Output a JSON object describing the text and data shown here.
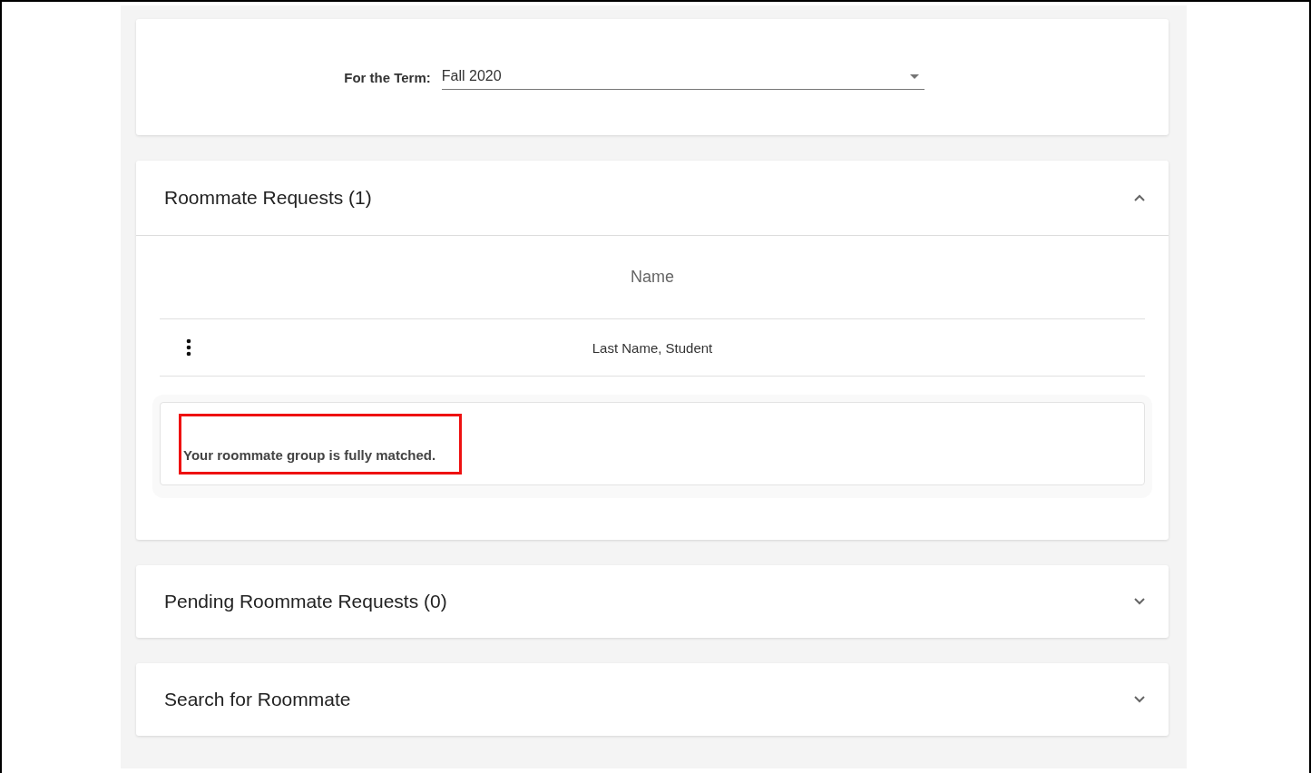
{
  "term": {
    "label": "For the Term:",
    "value": "Fall 2020"
  },
  "sections": [
    {
      "title": "Roommate Requests (1)",
      "expanded": true,
      "table": {
        "columns": [
          "Name"
        ],
        "rows": [
          {
            "name": "Last Name, Student"
          }
        ]
      },
      "message": {
        "text": "Your roommate group is fully matched.",
        "highlighted": true
      }
    },
    {
      "title": "Pending Roommate Requests (0)",
      "expanded": false
    },
    {
      "title": "Search for Roommate",
      "expanded": false
    }
  ]
}
